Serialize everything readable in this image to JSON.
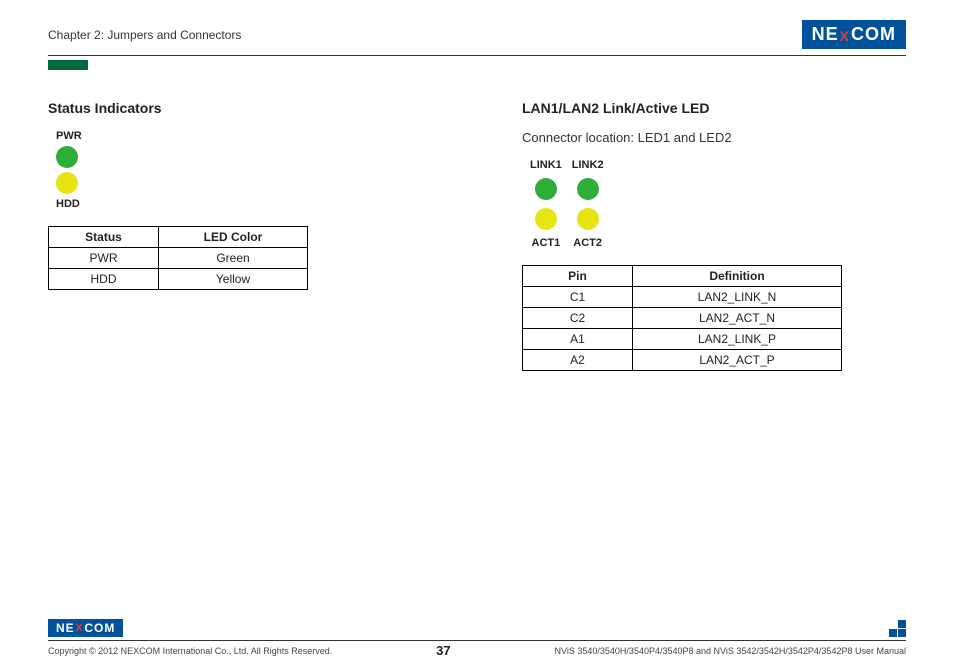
{
  "header": {
    "chapter": "Chapter 2: Jumpers and Connectors",
    "logo_parts": {
      "pre": "NE",
      "x": "X",
      "post": "COM"
    }
  },
  "left": {
    "heading": "Status Indicators",
    "pwr_label": "PWR",
    "hdd_label": "HDD",
    "table": {
      "h1": "Status",
      "h2": "LED Color",
      "rows": [
        {
          "status": "PWR",
          "color": "Green"
        },
        {
          "status": "HDD",
          "color": "Yellow"
        }
      ]
    }
  },
  "right": {
    "heading": "LAN1/LAN2 Link/Active LED",
    "subtext": "Connector location: LED1 and LED2",
    "labels": {
      "link1": "LINK1",
      "link2": "LINK2",
      "act1": "ACT1",
      "act2": "ACT2"
    },
    "table": {
      "h1": "Pin",
      "h2": "Definition",
      "rows": [
        {
          "pin": "C1",
          "def": "LAN2_LINK_N"
        },
        {
          "pin": "C2",
          "def": "LAN2_ACT_N"
        },
        {
          "pin": "A1",
          "def": "LAN2_LINK_P"
        },
        {
          "pin": "A2",
          "def": "LAN2_ACT_P"
        }
      ]
    }
  },
  "footer": {
    "copyright": "Copyright © 2012 NEXCOM International Co., Ltd. All Rights Reserved.",
    "page": "37",
    "manual": "NViS 3540/3540H/3540P4/3540P8 and NViS 3542/3542H/3542P4/3542P8 User Manual"
  }
}
